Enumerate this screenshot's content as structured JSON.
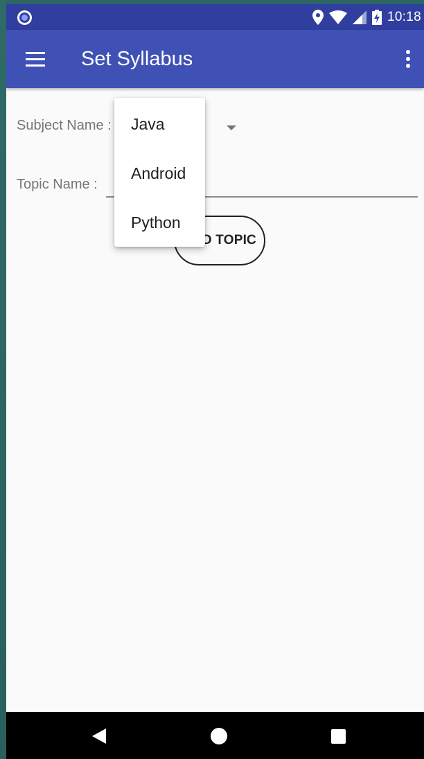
{
  "status_bar": {
    "time": "10:18",
    "icons": [
      "app-notification-icon",
      "location-icon",
      "wifi-icon",
      "cell-signal-icon",
      "battery-charging-icon"
    ]
  },
  "app_bar": {
    "title": "Set Syllabus",
    "menu_icon": "hamburger-menu-icon",
    "overflow_icon": "more-vert-icon",
    "color": "#3f51b5",
    "status_color": "#303f9f"
  },
  "form": {
    "subject_label": "Subject Name :",
    "topic_label": "Topic Name :",
    "topic_value": "",
    "add_topic_label": "ADD TOPIC"
  },
  "dropdown": {
    "items": [
      {
        "label": "Java"
      },
      {
        "label": "Android"
      },
      {
        "label": "Python"
      }
    ]
  },
  "nav_bar": {
    "buttons": [
      "back-icon",
      "home-icon",
      "recents-icon"
    ]
  }
}
